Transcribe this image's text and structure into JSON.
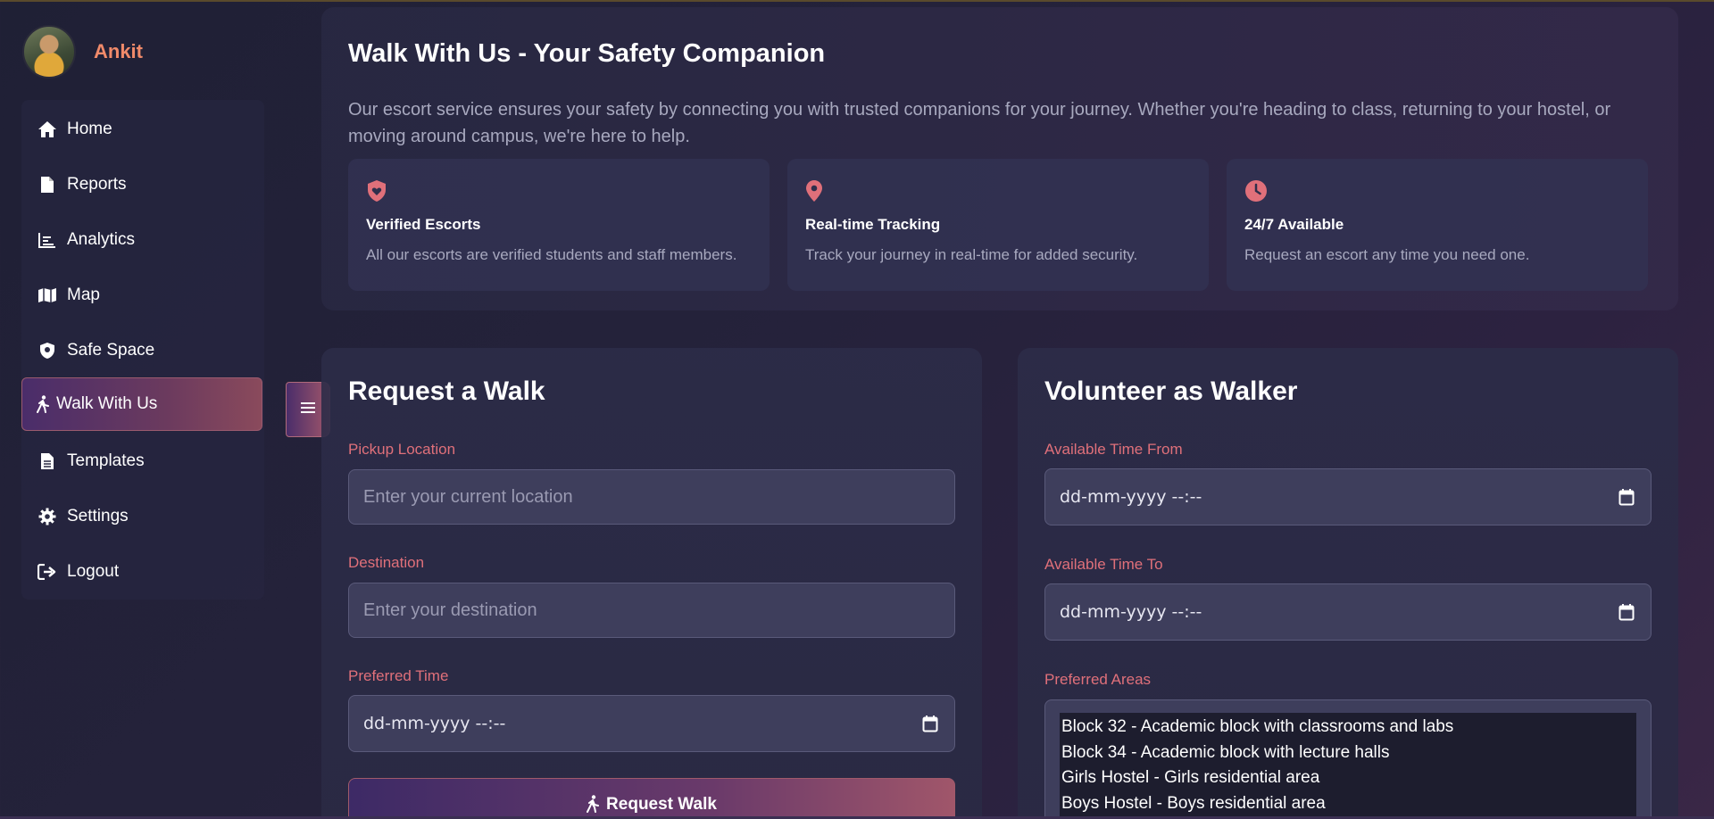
{
  "user": {
    "name": "Ankit"
  },
  "sidebar": {
    "items": [
      {
        "label": "Home",
        "icon": "home-icon"
      },
      {
        "label": "Reports",
        "icon": "file-icon"
      },
      {
        "label": "Analytics",
        "icon": "chart-icon"
      },
      {
        "label": "Map",
        "icon": "map-icon"
      },
      {
        "label": "Safe Space",
        "icon": "shield-icon"
      },
      {
        "label": "Walk With Us",
        "icon": "walking-icon",
        "active": true
      },
      {
        "label": "Templates",
        "icon": "file-lines-icon"
      },
      {
        "label": "Settings",
        "icon": "gear-icon"
      },
      {
        "label": "Logout",
        "icon": "logout-icon"
      }
    ]
  },
  "hero": {
    "title": "Walk With Us - Your Safety Companion",
    "description": "Our escort service ensures your safety by connecting you with trusted companions for your journey. Whether you're heading to class, returning to your hostel, or moving around campus, we're here to help.",
    "features": [
      {
        "icon": "shield-heart-icon",
        "title": "Verified Escorts",
        "desc": "All our escorts are verified students and staff members."
      },
      {
        "icon": "location-pin-icon",
        "title": "Real-time Tracking",
        "desc": "Track your journey in real-time for added security."
      },
      {
        "icon": "clock-icon",
        "title": "24/7 Available",
        "desc": "Request an escort any time you need one."
      }
    ]
  },
  "request": {
    "title": "Request a Walk",
    "pickup_label": "Pickup Location",
    "pickup_placeholder": "Enter your current location",
    "destination_label": "Destination",
    "destination_placeholder": "Enter your destination",
    "time_label": "Preferred Time",
    "time_value": "dd-mm-yyyy --:--",
    "submit_label": "Request Walk"
  },
  "volunteer": {
    "title": "Volunteer as Walker",
    "from_label": "Available Time From",
    "from_value": "dd-mm-yyyy --:--",
    "to_label": "Available Time To",
    "to_value": "dd-mm-yyyy --:--",
    "areas_label": "Preferred Areas",
    "areas": [
      "Block 32 - Academic block with classrooms and labs",
      "Block 34 - Academic block with lecture halls",
      "Girls Hostel - Girls residential area",
      "Boys Hostel - Boys residential area"
    ]
  },
  "colors": {
    "accent": "#e0707a",
    "name": "#f08a6a",
    "bg": "#25223b"
  }
}
